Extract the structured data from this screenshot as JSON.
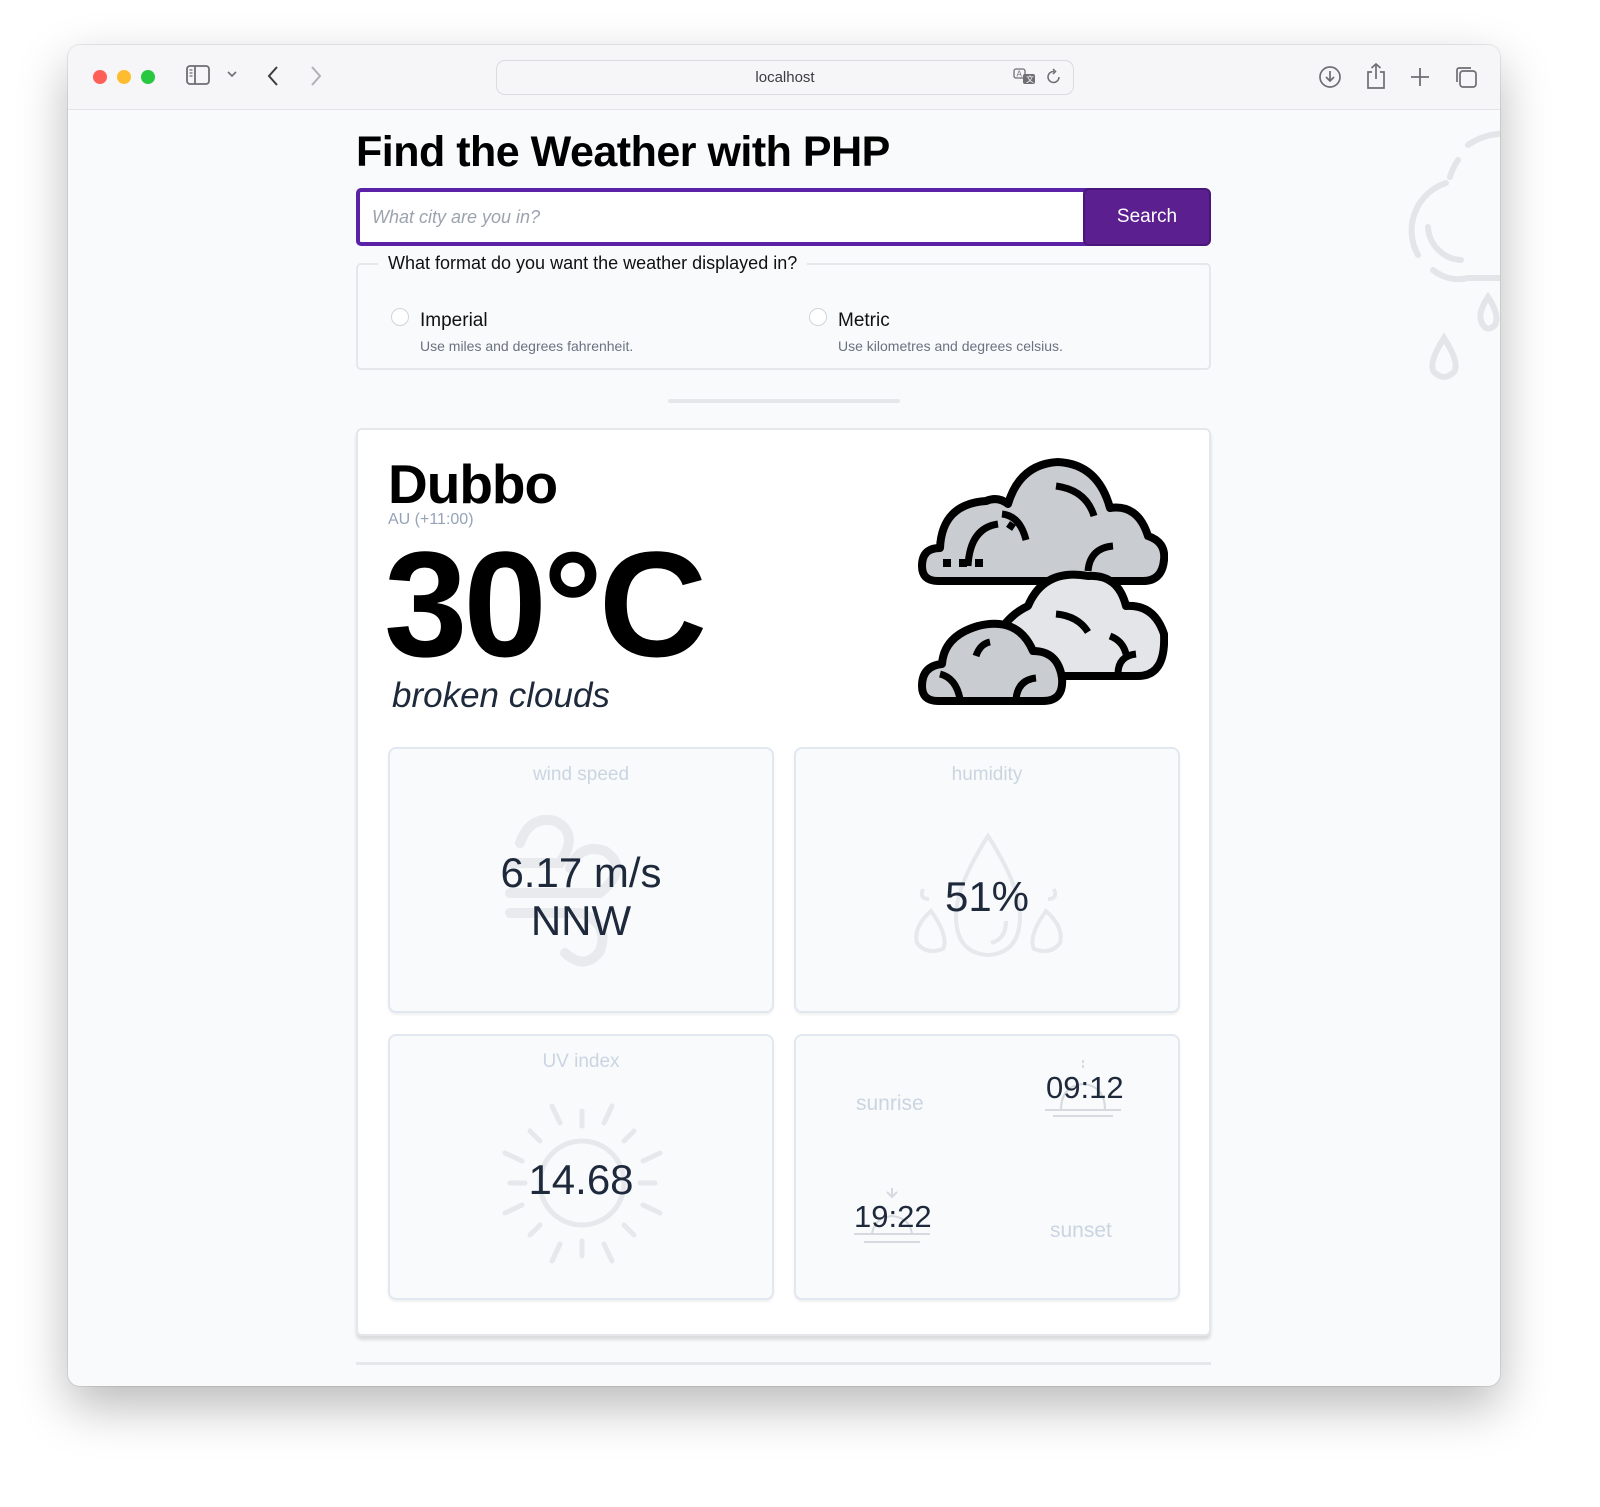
{
  "browser": {
    "address": "localhost",
    "icons": [
      "sidebar-icon",
      "chevron-down-icon",
      "back-icon",
      "forward-icon",
      "translate-icon",
      "reload-icon",
      "download-icon",
      "share-icon",
      "new-tab-icon",
      "tabs-overview-icon"
    ]
  },
  "page": {
    "title": "Find the Weather with PHP",
    "search": {
      "placeholder": "What city are you in?",
      "value": "",
      "button_label": "Search"
    },
    "format": {
      "legend": "What format do you want the weather displayed in?",
      "options": [
        {
          "label": "Imperial",
          "description": "Use miles and degrees fahrenheit.",
          "selected": false
        },
        {
          "label": "Metric",
          "description": "Use kilometres and degrees celsius.",
          "selected": false
        }
      ]
    }
  },
  "weather": {
    "city": "Dubbo",
    "country_tz": "AU (+11:00)",
    "temperature": "30°C",
    "description": "broken clouds",
    "icon": "broken-clouds-icon",
    "tiles": {
      "wind": {
        "label": "wind speed",
        "speed": "6.17 m/s",
        "direction": "NNW"
      },
      "humidity": {
        "label": "humidity",
        "value": "51%"
      },
      "uv": {
        "label": "UV index",
        "value": "14.68"
      },
      "sun": {
        "sunrise_label": "sunrise",
        "sunrise_time": "09:12",
        "sunset_label": "sunset",
        "sunset_time": "19:22"
      }
    }
  },
  "colors": {
    "accent": "#5b1f8f",
    "input_border": "#5b21a6",
    "muted_label": "#cbd5e1",
    "value_text": "#1e293b"
  }
}
